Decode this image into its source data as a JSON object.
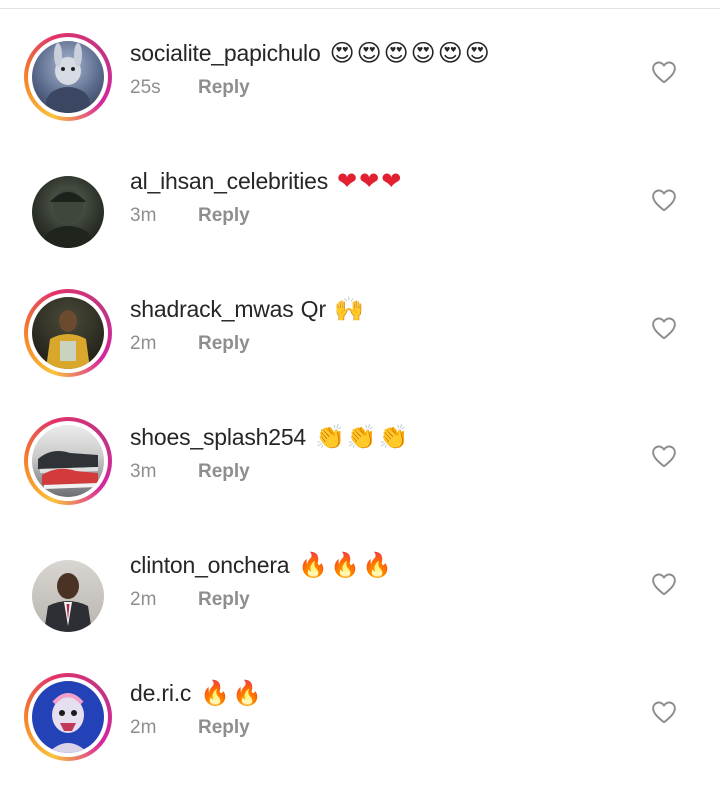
{
  "comments": [
    {
      "username": "socialite_papichulo",
      "text": "",
      "emojis": [
        "😍",
        "😍",
        "😍",
        "😍",
        "😍",
        "😍"
      ],
      "time": "25s",
      "reply_label": "Reply",
      "avatar_colors": [
        "#3a4a66",
        "#7c8fb0"
      ]
    },
    {
      "username": "al_ihsan_celebrities",
      "text": "",
      "emojis": [
        "❤",
        "❤",
        "❤"
      ],
      "time": "3m",
      "reply_label": "Reply",
      "avatar_colors": [
        "#1f231e",
        "#4b5546"
      ]
    },
    {
      "username": "shadrack_mwas",
      "text": "Qr",
      "emojis": [
        "🙌"
      ],
      "time": "2m",
      "reply_label": "Reply",
      "avatar_colors": [
        "#2a2a20",
        "#c9a03a"
      ]
    },
    {
      "username": "shoes_splash254",
      "text": "",
      "emojis": [
        "👏",
        "👏",
        "👏"
      ],
      "time": "3m",
      "reply_label": "Reply",
      "avatar_colors": [
        "#3d3f44",
        "#d8d8d8"
      ]
    },
    {
      "username": "clinton_onchera",
      "text": "",
      "emojis": [
        "🔥",
        "🔥",
        "🔥"
      ],
      "time": "2m",
      "reply_label": "Reply",
      "avatar_colors": [
        "#2e2e33",
        "#8a7a6c"
      ]
    },
    {
      "username": "de.ri.c",
      "text": "",
      "emojis": [
        "🔥",
        "🔥"
      ],
      "time": "2m",
      "reply_label": "Reply",
      "avatar_colors": [
        "#1f3fb0",
        "#d9d3e8"
      ]
    }
  ],
  "icons": {
    "like": "heart-outline-icon"
  },
  "colors": {
    "text": "#262626",
    "secondary": "#8e8e8e",
    "heart": "#e2202f"
  }
}
